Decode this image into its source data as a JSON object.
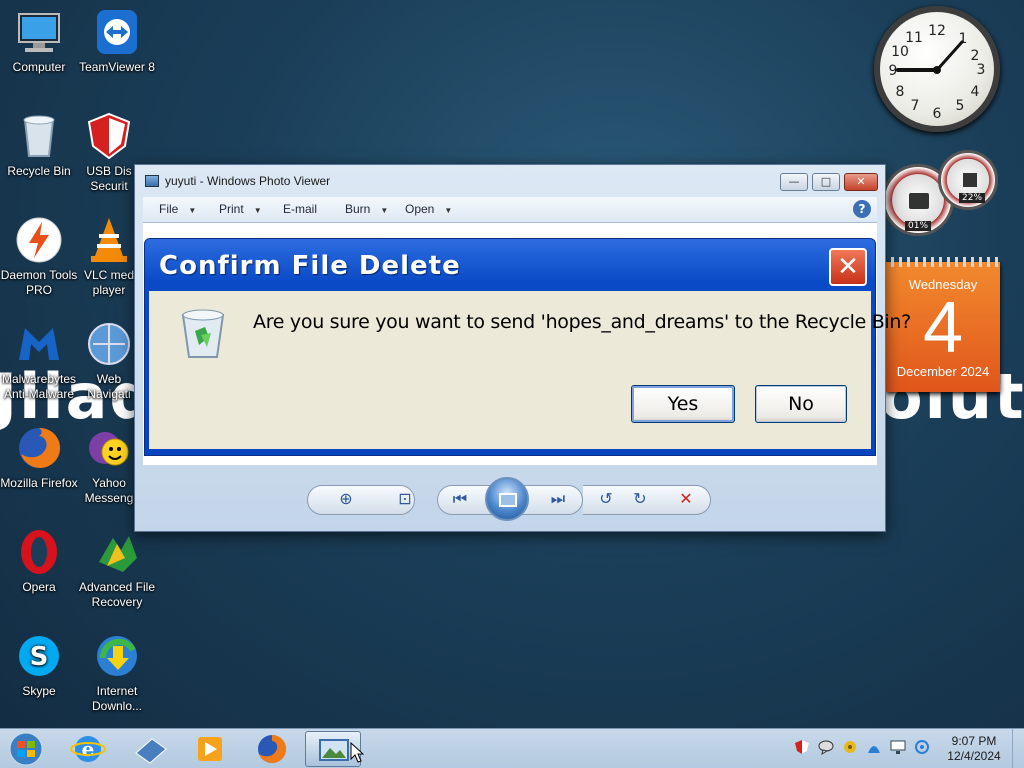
{
  "desktop": {
    "wallpaper_text_left": "Jllad Sy",
    "wallpaper_text_right": "olution",
    "icons": [
      {
        "label": "Computer",
        "icon": "computer-icon"
      },
      {
        "label": "TeamViewer 8",
        "icon": "teamviewer-icon"
      },
      {
        "label": "Recycle Bin",
        "icon": "recycle-bin-icon"
      },
      {
        "label": "USB Dis Securit",
        "icon": "usb-security-icon"
      },
      {
        "label": "Daemon Tools PRO",
        "icon": "daemon-tools-icon"
      },
      {
        "label": "VLC med player",
        "icon": "vlc-icon"
      },
      {
        "label": "Malwarebytes Anti-Malware",
        "icon": "malwarebytes-icon"
      },
      {
        "label": "Web Navigati",
        "icon": "web-navigator-icon"
      },
      {
        "label": "Mozilla Firefox",
        "icon": "firefox-icon"
      },
      {
        "label": "Yahoo Messeng",
        "icon": "yahoo-messenger-icon"
      },
      {
        "label": "Opera",
        "icon": "opera-icon"
      },
      {
        "label": "Advanced File Recovery",
        "icon": "file-recovery-icon"
      },
      {
        "label": "Skype",
        "icon": "skype-icon"
      },
      {
        "label": "Internet Downlo...",
        "icon": "internet-download-manager-icon"
      }
    ]
  },
  "gadgets": {
    "clock_numbers": [
      "12",
      "1",
      "2",
      "3",
      "4",
      "5",
      "6",
      "7",
      "8",
      "9",
      "10",
      "11"
    ],
    "cpu_percent": "01%",
    "ram_percent": "22%",
    "calendar": {
      "weekday": "Wednesday",
      "day": "4",
      "month_year": "December 2024"
    }
  },
  "photo_viewer": {
    "title": "yuyuti - Windows Photo Viewer",
    "menu": [
      "File",
      "Print",
      "E-mail",
      "Burn",
      "Open"
    ],
    "menu_has_dropdown": [
      true,
      true,
      false,
      true,
      true
    ],
    "help_label": "?",
    "minimize_label": "—",
    "maximize_label": "□",
    "close_label": "✕"
  },
  "dialog": {
    "title": "Confirm File Delete",
    "message": "Are you sure you want to send 'hopes_and_dreams' to the Recycle Bin?",
    "yes_label": "Yes",
    "no_label": "No",
    "close_label": "✕"
  },
  "taskbar": {
    "apps": [
      "internet-explorer-icon",
      "windows-live-icon",
      "media-player-icon",
      "firefox-icon",
      "photo-viewer-icon"
    ],
    "active_app": "photo-viewer-icon",
    "tray_icons": [
      "security-shield-icon",
      "messenger-icon",
      "tool-icon",
      "network-icon",
      "display-icon",
      "sync-icon"
    ],
    "time": "9:07 PM",
    "date": "12/4/2024"
  },
  "colors": {
    "dialog_titlebar": "#0a4ac6",
    "dialog_body": "#ece9d8",
    "calendar": "#e86a22",
    "close_red": "#c8311a"
  }
}
